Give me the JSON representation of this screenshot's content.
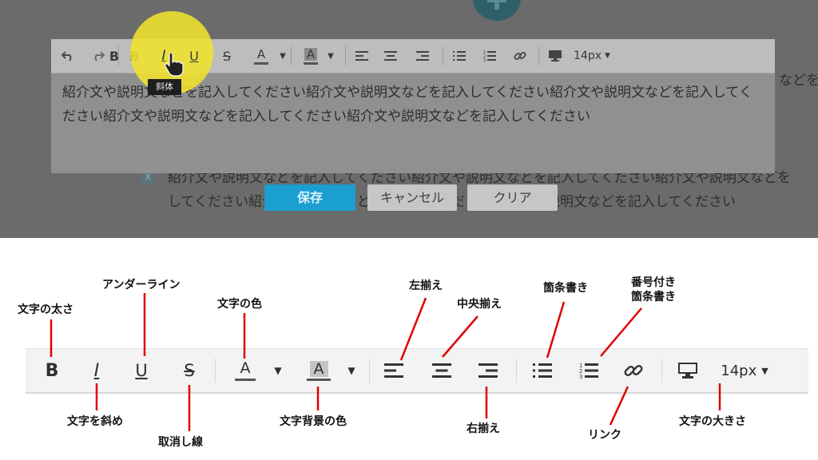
{
  "editor": {
    "text": "紹介文や説明文などを記入してください紹介文や説明文などを記入してください紹介文や説明文などを記入してください紹介文や説明文などを記入してください紹介文や説明文などを記入してください",
    "font_size": "14px",
    "tooltip": "斜体",
    "background_text_right": "などを",
    "background_line1": "紹介文や説明文などを記入してください紹介文や説明文などを記入してください紹介文や説明文などを",
    "background_line2": "してください紹介文や説明文などを記入してください紹介文や説明文などを記入してください",
    "x_mark": "x"
  },
  "buttons": {
    "save": "保存",
    "cancel": "キャンセル",
    "clear": "クリア"
  },
  "toolbar_glyphs": {
    "bold": "B",
    "italic": "I",
    "underline": "U",
    "strike": "S",
    "text_color": "A",
    "bg_color": "A"
  },
  "labels": {
    "bold": "文字の太さ",
    "underline": "アンダーライン",
    "italic": "文字を斜め",
    "strike": "取消し線",
    "text_color": "文字の色",
    "bg_color": "文字背景の色",
    "align_left": "左揃え",
    "align_center": "中央揃え",
    "align_right": "右揃え",
    "bullet_list": "箇条書き",
    "numbered_list_1": "番号付き",
    "numbered_list_2": "箇条書き",
    "link": "リンク",
    "font_size": "文字の大きさ"
  },
  "colors": {
    "save_button": "#1a9fd0",
    "highlight": "#f0e22d",
    "annotation_line": "#e00000"
  }
}
